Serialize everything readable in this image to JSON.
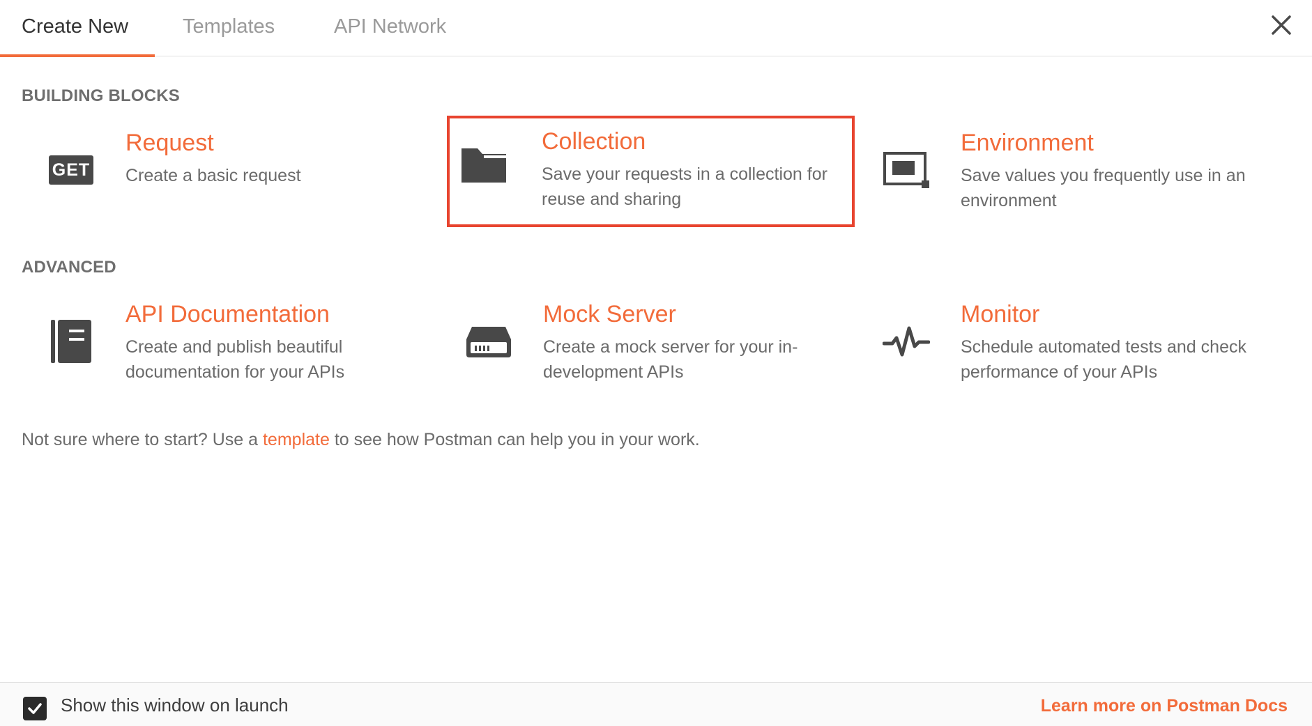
{
  "tabs": [
    {
      "label": "Create New",
      "active": true
    },
    {
      "label": "Templates",
      "active": false
    },
    {
      "label": "API Network",
      "active": false
    }
  ],
  "sections": {
    "building_blocks": "BUILDING BLOCKS",
    "advanced": "ADVANCED"
  },
  "cards": {
    "request": {
      "title": "Request",
      "desc": "Create a basic request",
      "icon": "get-icon",
      "badge": "GET"
    },
    "collection": {
      "title": "Collection",
      "desc": "Save your requests in a collection for reuse and sharing",
      "icon": "folder-icon",
      "highlighted": true
    },
    "environment": {
      "title": "Environment",
      "desc": "Save values you frequently use in an environment",
      "icon": "environment-icon"
    },
    "api_documentation": {
      "title": "API Documentation",
      "desc": "Create and publish beautiful documentation for your APIs",
      "icon": "documentation-icon"
    },
    "mock_server": {
      "title": "Mock Server",
      "desc": "Create a mock server for your in-development APIs",
      "icon": "server-icon"
    },
    "monitor": {
      "title": "Monitor",
      "desc": "Schedule automated tests and check performance of your APIs",
      "icon": "pulse-icon"
    }
  },
  "hint": {
    "before": "Not sure where to start? Use a ",
    "link": "template",
    "after": " to see how Postman can help you in your work."
  },
  "footer": {
    "checkbox_label": "Show this window on launch",
    "checkbox_checked": true,
    "docs_link": "Learn more on Postman Docs"
  },
  "colors": {
    "accent": "#f26b3a",
    "highlight_border": "#e8442f",
    "icon": "#484848"
  }
}
